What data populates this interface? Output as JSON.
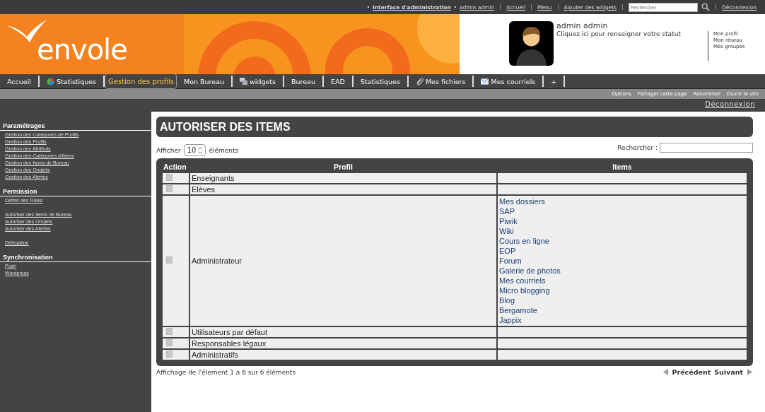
{
  "top_bar": {
    "links": [
      {
        "label": "Interface d'administration",
        "bold": true
      },
      {
        "label": "admin admin",
        "bold": false
      }
    ],
    "menu_links": [
      "Accueil",
      "Menu",
      "Ajouter des widgets"
    ],
    "search": {
      "placeholder": "Rechercher"
    },
    "logout": "Déconnexion"
  },
  "header": {
    "logo": "envole",
    "user_name": "admin admin",
    "status_prompt": "Cliquez ici pour renseigner votre statut",
    "profile_links": [
      "Mon profil",
      "Mon réseau",
      "Mes groupes"
    ]
  },
  "nav_tabs": [
    {
      "label": "Accueil",
      "kind": "text",
      "selected": false
    },
    {
      "label": "Statistiques",
      "kind": "pie",
      "selected": false
    },
    {
      "label": "Gestion des profils",
      "kind": "text",
      "selected": true
    },
    {
      "label": "Mon Bureau",
      "kind": "text",
      "selected": false
    },
    {
      "label": "widgets",
      "kind": "windows",
      "selected": false
    },
    {
      "label": "Bureau",
      "kind": "text",
      "selected": false
    },
    {
      "label": "EAD",
      "kind": "text",
      "selected": false
    },
    {
      "label": "Statistiques",
      "kind": "text",
      "selected": false
    },
    {
      "label": "Mes fichiers",
      "kind": "clip",
      "selected": false
    },
    {
      "label": "Mes courriels",
      "kind": "mail",
      "selected": false
    },
    {
      "label": "+",
      "kind": "text",
      "selected": false
    }
  ],
  "page_options": [
    "Options",
    "Partager cette page",
    "Renommer",
    "Ouvrir le site"
  ],
  "page_logout": "Déconnexion",
  "sidebar": [
    {
      "heading": "Paramétrages",
      "groups": [
        [
          "Gestion des Catégories de Profils",
          "Gestion des Profils",
          "Gestion des Attributs",
          "Gestion des Catégories d'Items",
          "Gestion des Items de Bureau",
          "Gestion des Onglets",
          "Gestion des Alertes"
        ]
      ]
    },
    {
      "heading": "Permission",
      "groups": [
        [
          "Définir des Rôles"
        ],
        [
          "Autoriser des Items de Bureau",
          "Autoriser des Onglets",
          "Autoriser des Alertes"
        ],
        [
          "Délégation"
        ]
      ]
    },
    {
      "heading": "Synchronisation",
      "groups": [
        [
          "Posh",
          "Wordpress"
        ]
      ]
    }
  ],
  "page_title": "AUTORISER DES ITEMS",
  "length_control": {
    "before": "Afficher",
    "value": "10",
    "after": "éléments"
  },
  "filter": {
    "label": "Rechercher :"
  },
  "table": {
    "columns": [
      "Action",
      "Profil",
      "Items"
    ],
    "rows": [
      {
        "profil": "Enseignants",
        "items": []
      },
      {
        "profil": "Elèves",
        "items": []
      },
      {
        "profil": "Administrateur",
        "items": [
          "Mes dossiers",
          "SAP",
          "Piwik",
          "Wiki",
          "Cours en ligne",
          "EOP",
          "Forum",
          "Galerie de photos",
          "Mes courriels",
          "Micro blogging",
          "Blog",
          "Bergamote",
          "Jappix"
        ]
      },
      {
        "profil": "Utilisateurs par défaut",
        "items": []
      },
      {
        "profil": "Responsables légaux",
        "items": []
      },
      {
        "profil": "Administratifs",
        "items": []
      }
    ]
  },
  "table_info": "Affichage de l'élement 1 à 6 sur 6 éléments",
  "pagination": {
    "previous": "Précédent",
    "next": "Suivant"
  }
}
